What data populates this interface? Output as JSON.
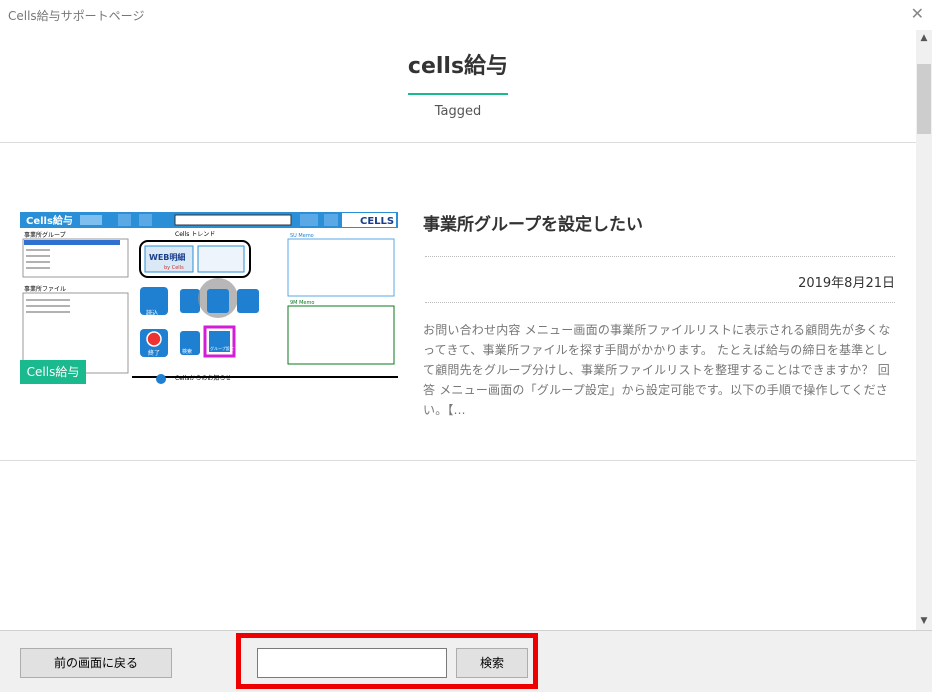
{
  "window": {
    "title": "Cells給与サポートページ",
    "close_symbol": "✕"
  },
  "header": {
    "site_title": "cells給与",
    "subtitle": "Tagged"
  },
  "post": {
    "title": "事業所グループを設定したい",
    "date": "2019年8月21日",
    "excerpt": "お問い合わせ内容 メニュー画面の事業所ファイルリストに表示される顧問先が多くなってきて、事業所ファイルを探す手間がかかります。 たとえば給与の締日を基準として顧問先をグループ分けし、事業所ファイルリストを整理することはできますか？ 回答 メニュー画面の「グループ設定」から設定可能です。以下の手順で操作してください。【...",
    "thumbnail": {
      "badge": "Cells給与",
      "app_title": "Cells給与",
      "logo": "CELLS",
      "group_label": "事業所グループ",
      "file_label": "事業所ファイル",
      "trend_label": "Cells トレンド",
      "web_label": "WEB明細",
      "web_sub": "by Cells",
      "memo1": "SU Memo",
      "memo2": "9M Memo",
      "notice": "Cellsからのお知らせ",
      "btn_open": "読込",
      "btn_end": "終了",
      "btn_search": "検索",
      "btn_group": "グループ設定"
    }
  },
  "footer": {
    "back_label": "前の画面に戻る",
    "search_placeholder": "",
    "search_label": "検索"
  },
  "scrollbar": {
    "up_symbol": "▲",
    "down_symbol": "▼"
  }
}
